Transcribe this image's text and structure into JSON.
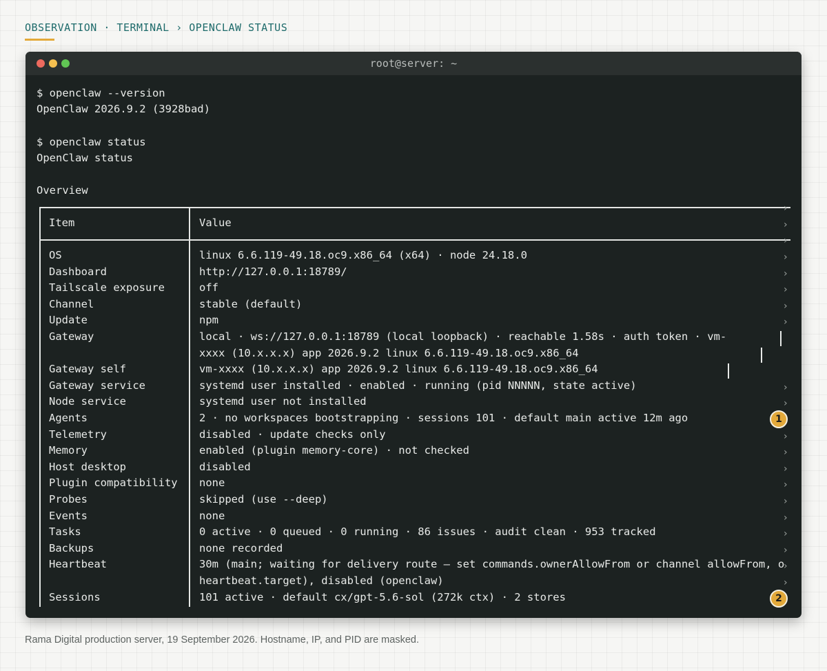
{
  "header": {
    "breadcrumb": "OBSERVATION · TERMINAL › OPENCLAW STATUS"
  },
  "window": {
    "title": "root@server: ~"
  },
  "terminal": {
    "cmd1": "$ openclaw --version",
    "out1": "OpenClaw 2026.9.2 (3928bad)",
    "cmd2": "$ openclaw status",
    "out2": "OpenClaw status",
    "section": "Overview",
    "table_headers": {
      "item": "Item",
      "value": "Value"
    },
    "rows": [
      {
        "item": "OS",
        "value": "linux 6.6.119-49.18.oc9.x86_64 (x64) · node 24.18.0"
      },
      {
        "item": "Dashboard",
        "value": "http://127.0.0.1:18789/"
      },
      {
        "item": "Tailscale exposure",
        "value": "off"
      },
      {
        "item": "Channel",
        "value": "stable (default)"
      },
      {
        "item": "Update",
        "value": "npm"
      },
      {
        "item": "Gateway",
        "value": "local · ws://127.0.0.1:18789 (local loopback) · reachable 1.58s · auth token · vm-",
        "value2": "xxxx (10.x.x.x) app 2026.9.2 linux 6.6.119-49.18.oc9.x86_64"
      },
      {
        "item": "Gateway self",
        "value": "vm-xxxx (10.x.x.x) app 2026.9.2 linux 6.6.119-49.18.oc9.x86_64"
      },
      {
        "item": "Gateway service",
        "value": "systemd user installed · enabled · running (pid NNNNN, state active)"
      },
      {
        "item": "Node service",
        "value": "systemd user not installed"
      },
      {
        "item": "Agents",
        "value": "2 · no workspaces bootstrapping · sessions 101 · default main active 12m ago"
      },
      {
        "item": "Telemetry",
        "value": "disabled · update checks only"
      },
      {
        "item": "Memory",
        "value": "enabled (plugin memory-core) · not checked"
      },
      {
        "item": "Host desktop",
        "value": "disabled"
      },
      {
        "item": "Plugin compatibility",
        "value": "none"
      },
      {
        "item": "Probes",
        "value": "skipped (use --deep)"
      },
      {
        "item": "Events",
        "value": "none"
      },
      {
        "item": "Tasks",
        "value": "0 active · 0 queued · 0 running · 86 issues · audit clean · 953 tracked"
      },
      {
        "item": "Backups",
        "value": "none recorded"
      },
      {
        "item": "Heartbeat",
        "value": "30m (main; waiting for delivery route — set commands.ownerAllowFrom or channel allowFrom, o",
        "value2": "heartbeat.target), disabled (openclaw)"
      },
      {
        "item": "Sessions",
        "value": "101 active · default cx/gpt-5.6-sol (272k ctx) · 2 stores"
      }
    ],
    "chevron": "›"
  },
  "markers": [
    "1",
    "2"
  ],
  "caption": "Rama Digital production server, 19 September 2026. Hostname, IP, and PID are masked."
}
